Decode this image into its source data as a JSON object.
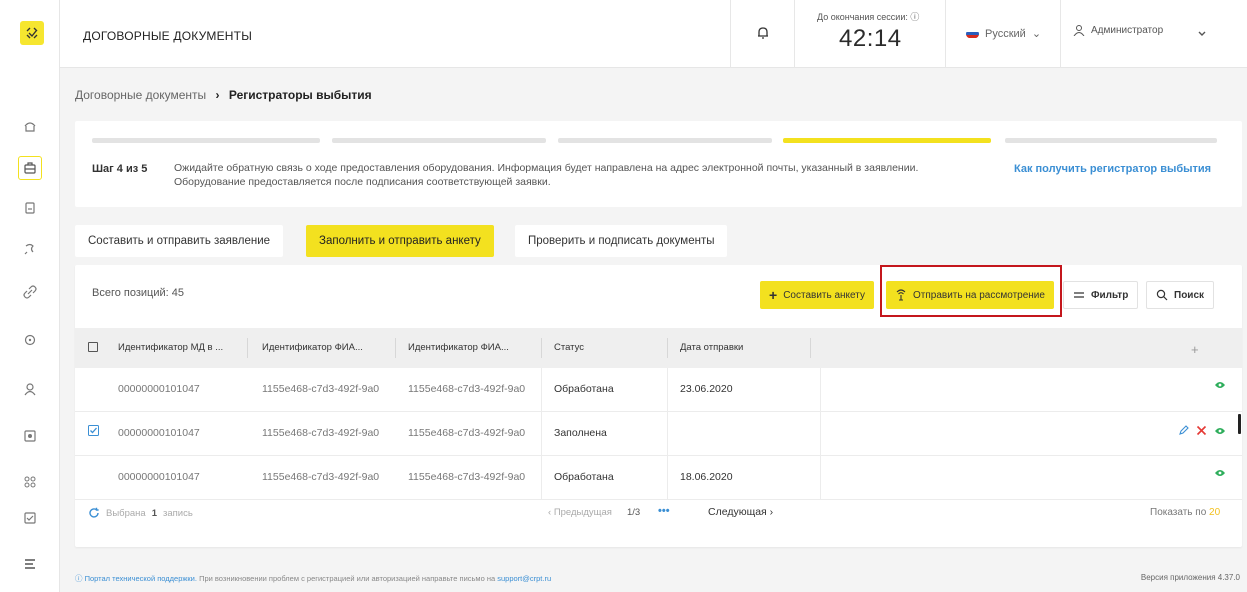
{
  "app": {
    "title": "ДОГОВОРНЫЕ ДОКУМЕНТЫ"
  },
  "sidebar": {
    "logo": "logo-icon",
    "items": [
      {
        "icon": "home-icon"
      },
      {
        "icon": "briefcase-icon",
        "active": true
      },
      {
        "icon": "document-icon"
      },
      {
        "icon": "transfer-icon"
      },
      {
        "icon": "link-icon"
      },
      {
        "icon": "refresh-icon"
      },
      {
        "icon": "user-icon"
      },
      {
        "icon": "calculator-icon"
      },
      {
        "icon": "grid-icon"
      },
      {
        "icon": "checklist-icon"
      },
      {
        "icon": "menu-icon"
      }
    ]
  },
  "header": {
    "session_label": "До окончания сессии:",
    "session_time": "42:14",
    "language": "Русский",
    "user": "Администратор"
  },
  "breadcrumb": {
    "parent": "Договорные документы",
    "separator": "›",
    "current": "Регистраторы выбытия"
  },
  "steps": {
    "label": "Шаг 4 из 5",
    "text": "Ожидайте обратную связь о ходе предоставления оборудования. Информация будет направлена на адрес электронной почты, указанный в заявлении. Оборудование предоставляется после подписания соответствующей заявки.",
    "link": "Как получить регистратор выбытия",
    "total": 5,
    "current": 4
  },
  "tabs": [
    {
      "label": "Составить и отправить заявление",
      "active": false
    },
    {
      "label": "Заполнить и отправить анкету",
      "active": true
    },
    {
      "label": "Проверить и подписать документы",
      "active": false
    }
  ],
  "table": {
    "total": "Всего позиций: 45",
    "buttons": {
      "create": "Составить анкету",
      "submit": "Отправить на рассмотрение",
      "filter": "Фильтр",
      "search": "Поиск"
    },
    "columns": [
      "Идентификатор МД в ...",
      "Идентификатор ФИА...",
      "Идентификатор ФИА...",
      "Статус",
      "Дата отправки"
    ],
    "rows": [
      {
        "id": "00000000101047",
        "fia1": "1155e468-c7d3-492f-9a0",
        "fia2": "1155e468-c7d3-492f-9a0",
        "status": "Обработана",
        "date": "23.06.2020",
        "checked": false
      },
      {
        "id": "00000000101047",
        "fia1": "1155e468-c7d3-492f-9a0",
        "fia2": "1155e468-c7d3-492f-9a0",
        "status": "Заполнена",
        "date": "",
        "checked": true
      },
      {
        "id": "00000000101047",
        "fia1": "1155e468-c7d3-492f-9a0",
        "fia2": "1155e468-c7d3-492f-9a0",
        "status": "Обработана",
        "date": "18.06.2020",
        "checked": false
      }
    ],
    "pager": {
      "selected_prefix": "Выбрана",
      "selected_count": "1",
      "selected_suffix": "запись",
      "prev": "Предыдущая",
      "page": "1/3",
      "dots": "•••",
      "next": "Следующая",
      "per_page_label": "Показать по",
      "per_page": "20"
    }
  },
  "footer": {
    "support_link": "Портал технической поддержки.",
    "text": "При возникновении проблем с регистрацией или авторизацией направьте письмо на",
    "email": "support@crpt.ru",
    "version": "Версия приложения 4.37.0"
  },
  "colors": {
    "accent": "#f3e11f",
    "link": "#3b8fd4",
    "highlight": "#c4161c",
    "eye": "#2fae5c",
    "delete": "#e53935"
  }
}
